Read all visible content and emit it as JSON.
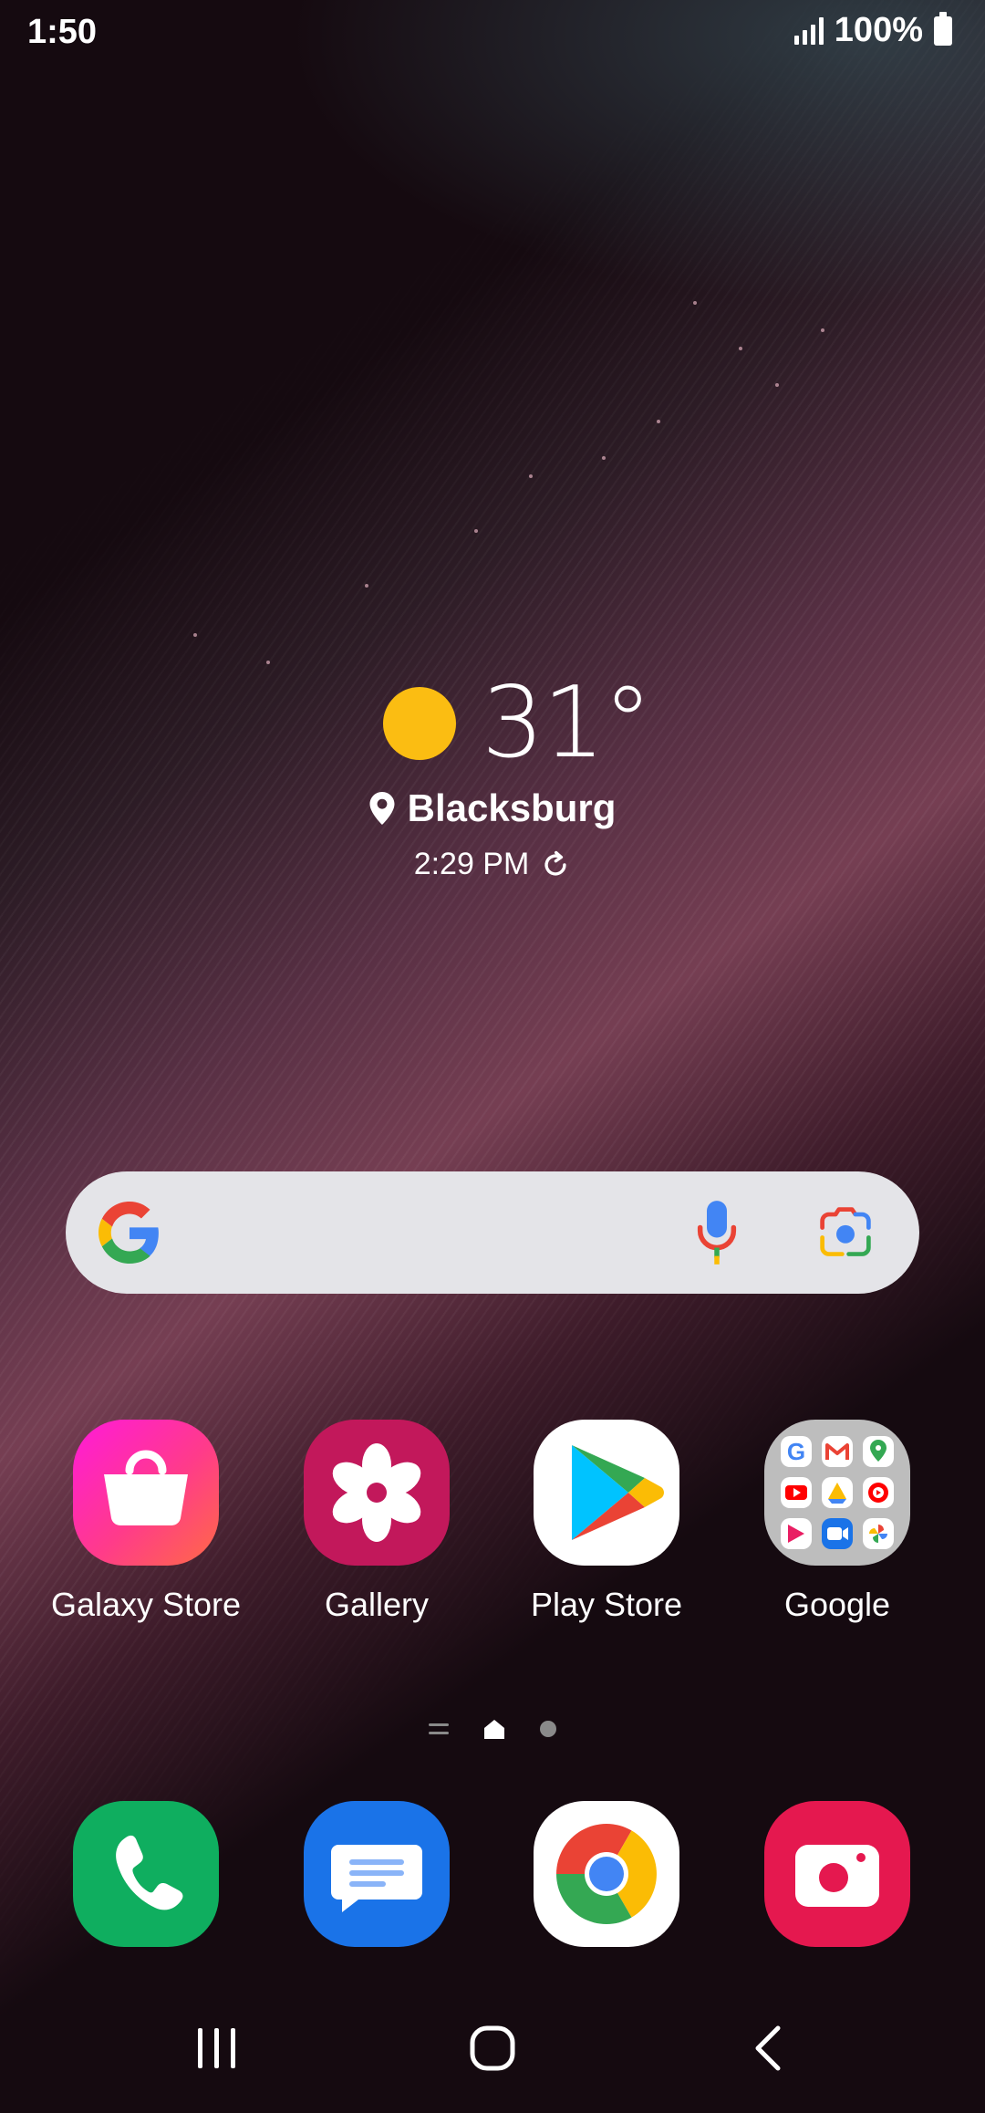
{
  "status_bar": {
    "time": "1:50",
    "battery": "100%"
  },
  "weather": {
    "temperature": "31°",
    "location": "Blacksburg",
    "updated": "2:29 PM"
  },
  "apps": [
    {
      "label": "Galaxy Store",
      "icon": "shopping-bag-icon",
      "color": "#ff2d87"
    },
    {
      "label": "Gallery",
      "icon": "flower-icon",
      "color": "#c2185b"
    },
    {
      "label": "Play Store",
      "icon": "play-triangle-icon",
      "color": "#ffffff"
    },
    {
      "label": "Google",
      "icon": "google-folder-icon",
      "color": "#bdbdbd"
    }
  ],
  "dock": [
    {
      "icon": "phone-icon",
      "color": "#0fae5f"
    },
    {
      "icon": "messages-icon",
      "color": "#1a73e8"
    },
    {
      "icon": "chrome-icon",
      "color": "#ffffff"
    },
    {
      "icon": "camera-icon",
      "color": "#e5184f"
    }
  ],
  "colors": {
    "sun": "#fbbd12",
    "search_bg": "#e4e4e8"
  }
}
